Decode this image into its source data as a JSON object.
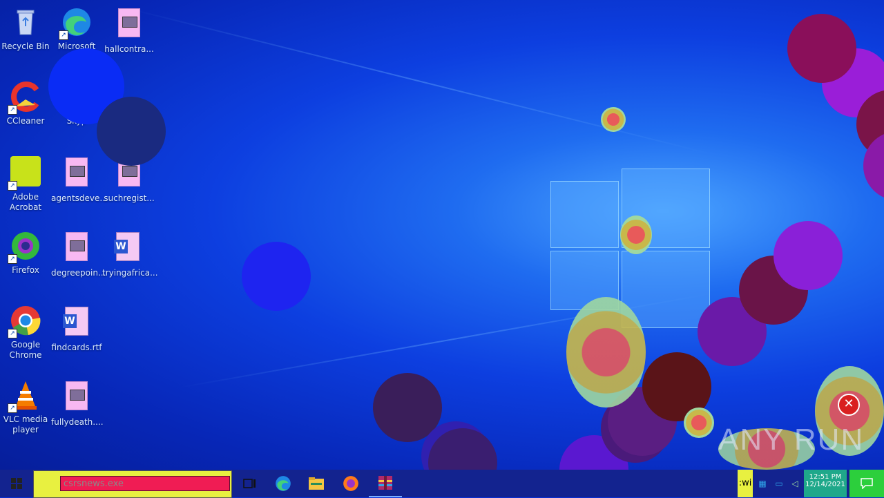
{
  "desktop_icons": [
    {
      "label": "Recycle Bin",
      "icon": "recycle-bin-icon"
    },
    {
      "label": "Microsoft",
      "icon": "edge-icon"
    },
    {
      "label": "hallcontra...",
      "icon": "image-file-icon"
    },
    {
      "label": "CCleaner",
      "icon": "ccleaner-icon"
    },
    {
      "label": "Skyp",
      "icon": "skype-icon"
    },
    {
      "label": "Adobe Acrobat",
      "icon": "acrobat-icon"
    },
    {
      "label": "agentsdeve...",
      "icon": "image-file-icon"
    },
    {
      "label": "suchregist...",
      "icon": "image-file-icon"
    },
    {
      "label": "Firefox",
      "icon": "firefox-icon"
    },
    {
      "label": "degreepoin...",
      "icon": "image-file-icon"
    },
    {
      "label": "tryingafrica...",
      "icon": "word-doc-icon"
    },
    {
      "label": "Google Chrome",
      "icon": "chrome-icon"
    },
    {
      "label": "findcards.rtf",
      "icon": "word-doc-icon"
    },
    {
      "label": "VLC media player",
      "icon": "vlc-icon"
    },
    {
      "label": "fullydeath....",
      "icon": "image-file-icon"
    }
  ],
  "taskbar": {
    "search_text": "csrsnews.exe",
    "pinned": [
      "task-view-icon",
      "edge-icon",
      "file-explorer-icon",
      "firefox-icon",
      "winrar-icon"
    ],
    "tray_label": ":wi",
    "clock_time": "12:51 PM",
    "clock_date": "12/14/2021"
  },
  "watermark": "ANY RUN"
}
